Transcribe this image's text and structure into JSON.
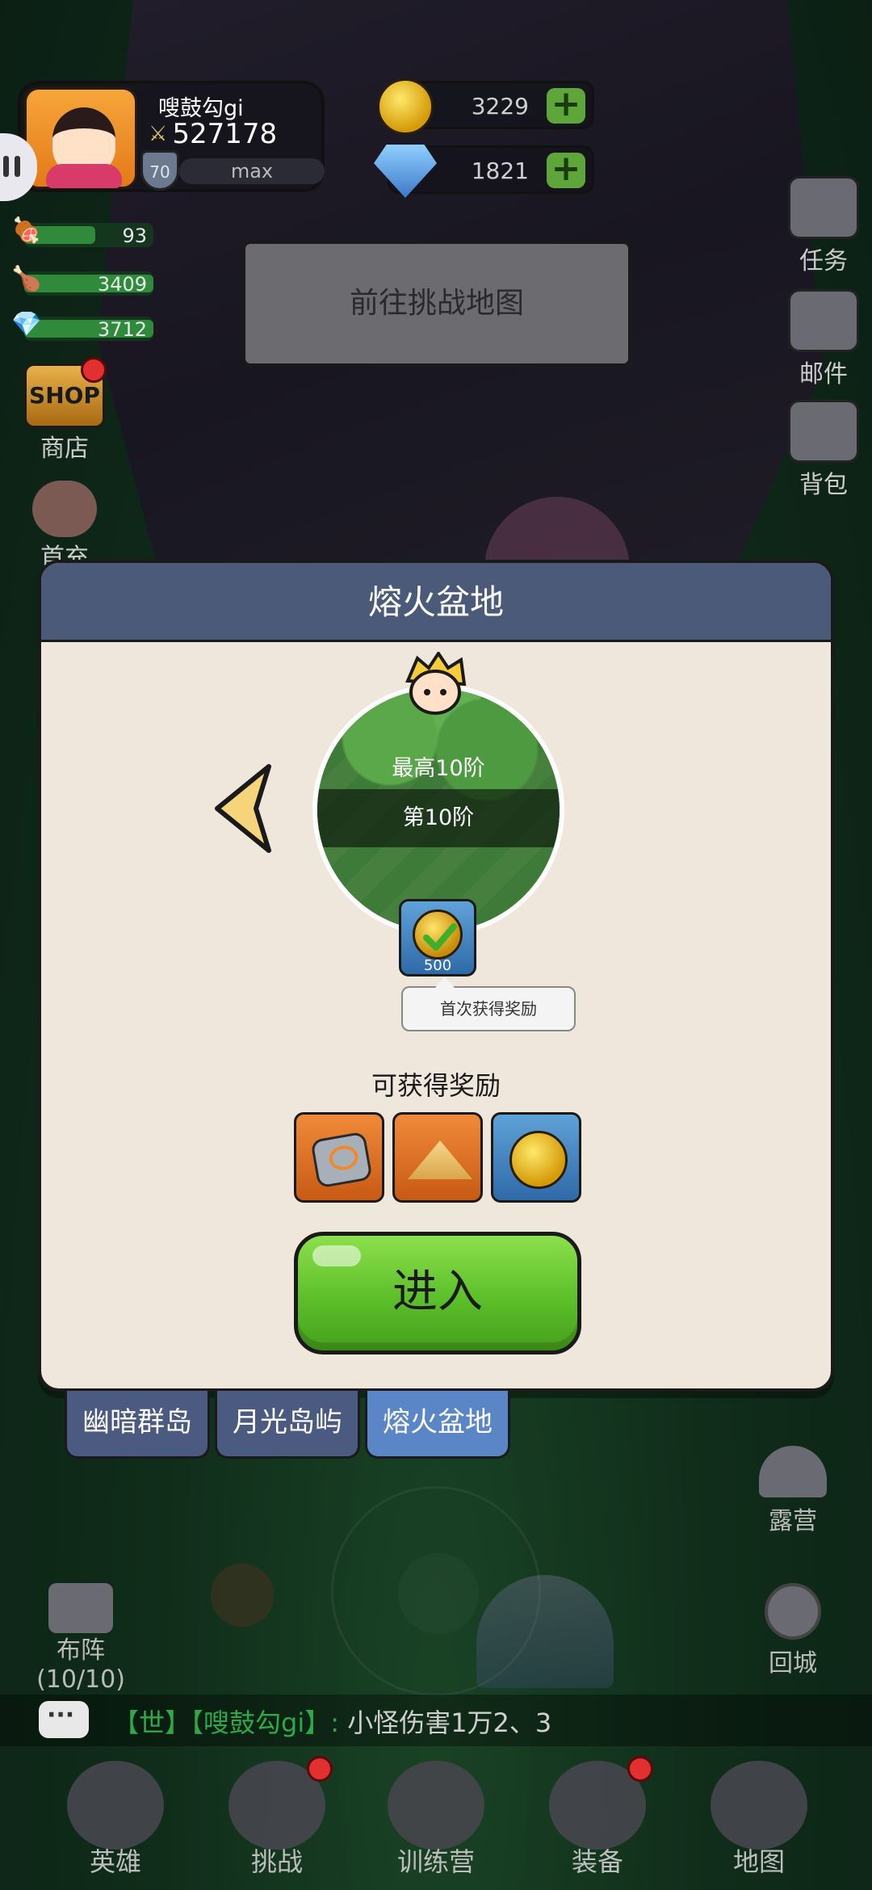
{
  "player": {
    "name": "嗖鼓勾gi",
    "power": "527178",
    "level": "70",
    "exp_label": "max"
  },
  "currency": {
    "gold": "3229",
    "diamond": "1821"
  },
  "resources": [
    {
      "icon": "meat-icon",
      "value": "93",
      "fill": 0.55
    },
    {
      "icon": "drumstick-icon",
      "value": "3409",
      "fill": 1.0
    },
    {
      "icon": "crystal-icon",
      "value": "3712",
      "fill": 1.0
    }
  ],
  "left_menu": {
    "shop_icon_text": "SHOP",
    "shop": "商店",
    "hero_entry_partial": "首充"
  },
  "right_menu": {
    "tasks": "任务",
    "mail": "邮件",
    "bag": "背包"
  },
  "challenge_button": "前往挑战地图",
  "modal": {
    "title": "熔火盆地",
    "best_stage": "最高10阶",
    "current_stage": "第10阶",
    "first_reward_count": "500",
    "first_reward_tip": "首次获得奖励",
    "rewards_title": "可获得奖励",
    "rewards": [
      "ore-icon",
      "sand-icon",
      "gold-coin-icon"
    ],
    "enter": "进入"
  },
  "map_tabs": [
    {
      "label": "幽暗群岛",
      "active": false
    },
    {
      "label": "月光岛屿",
      "active": false
    },
    {
      "label": "熔火盆地",
      "active": true
    }
  ],
  "camp": "露营",
  "return_town": "回城",
  "formation": {
    "label": "布阵",
    "count": "(10/10)"
  },
  "chat": {
    "channel": "【世】",
    "sender": "【嗖鼓勾gi】:",
    "message": "小怪伤害1万2、3"
  },
  "bottom_nav": [
    "英雄",
    "挑战",
    "训练营",
    "装备",
    "地图"
  ],
  "colors": {
    "enter_button": "#5cbf2a",
    "modal_header": "#4c5a7a",
    "active_tab": "#5a86c8",
    "chat_name": "#2fa84a"
  }
}
